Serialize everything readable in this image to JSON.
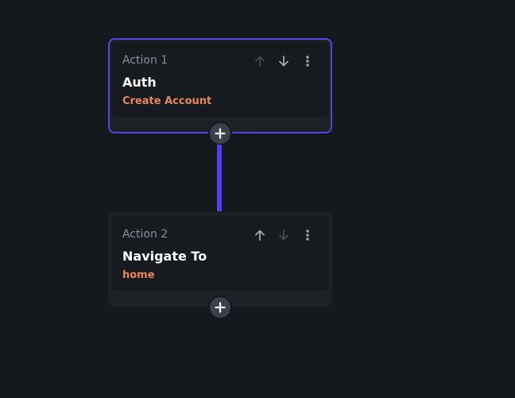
{
  "colors": {
    "background": "#15181c",
    "selected_border": "#4f46e5",
    "connector": "#4f3ff0",
    "accent_text": "#e9875a",
    "card_outer": "#1e2227",
    "card_inner": "#171a1e"
  },
  "actions": [
    {
      "label": "Action 1",
      "title": "Auth",
      "subtitle": "Create Account",
      "selected": true,
      "icons": [
        "arrow-up-icon",
        "arrow-down-icon",
        "more-vertical-icon"
      ],
      "move_up_enabled": false,
      "move_down_enabled": true
    },
    {
      "label": "Action 2",
      "title": "Navigate To",
      "subtitle": "home",
      "selected": false,
      "icons": [
        "arrow-up-icon",
        "arrow-down-icon",
        "more-vertical-icon"
      ],
      "move_up_enabled": true,
      "move_down_enabled": false
    }
  ],
  "add_icon": "plus-icon"
}
